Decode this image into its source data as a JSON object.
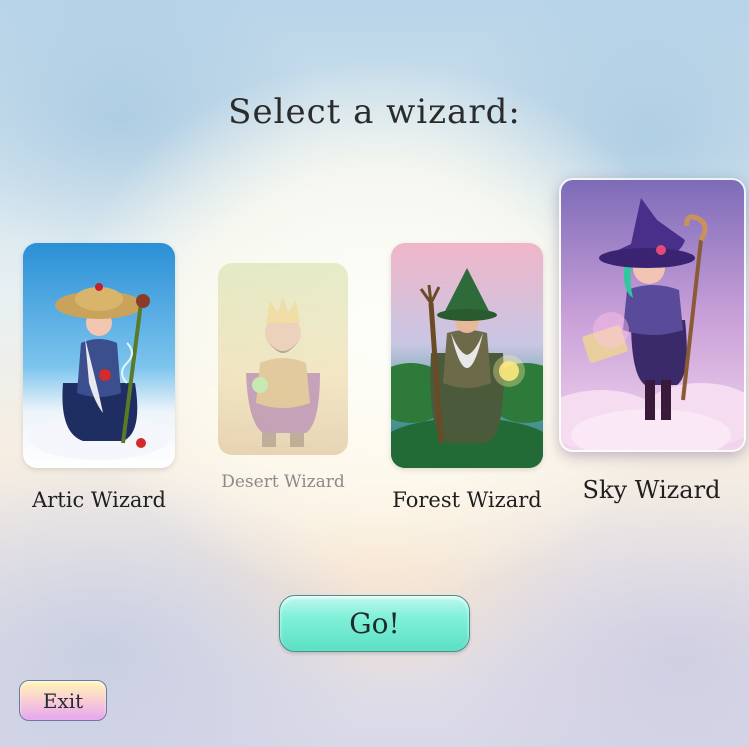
{
  "screen": {
    "title": "Select a wizard:"
  },
  "wizards": [
    {
      "name": "Artic Wizard",
      "state": "available",
      "art_icon": "artic-wizard-portrait"
    },
    {
      "name": "Desert Wizard",
      "state": "disabled",
      "art_icon": "desert-wizard-portrait"
    },
    {
      "name": "Forest Wizard",
      "state": "available",
      "art_icon": "forest-wizard-portrait"
    },
    {
      "name": "Sky Wizard",
      "state": "selected",
      "art_icon": "sky-wizard-portrait"
    }
  ],
  "buttons": {
    "go_label": "Go!",
    "exit_label": "Exit"
  },
  "colors": {
    "go_button": "#7ff0d8",
    "exit_button_top": "#fff7b5",
    "exit_button_bottom": "#e4a6f0",
    "title_text": "#2b2b2b"
  }
}
